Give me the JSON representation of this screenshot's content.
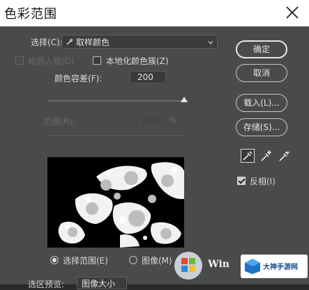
{
  "window": {
    "title": "色彩范围"
  },
  "select_row": {
    "label": "选择(C):",
    "value": "取样颜色"
  },
  "options": {
    "detect_faces": "检测人脸(D)",
    "localized_clusters": "本地化颜色簇(Z)",
    "fuzziness_label": "颜色容差(F):",
    "fuzziness_value": "200",
    "fuzziness_level": 1.0,
    "range_label": "范围(R):",
    "range_unit": "%",
    "invert": "反相(I)",
    "invert_checked": true
  },
  "buttons": {
    "ok": "确定",
    "cancel": "取消",
    "load": "载入(L)...",
    "save": "存储(S)..."
  },
  "display": {
    "selection": "选择范围(E)",
    "image": "图像(M)",
    "selected": "selection"
  },
  "bottom": {
    "partial_label": "选区预览:",
    "partial_value": "图像大小"
  },
  "watermark": {
    "win_text": "Win",
    "site_text": "大神手游网"
  }
}
